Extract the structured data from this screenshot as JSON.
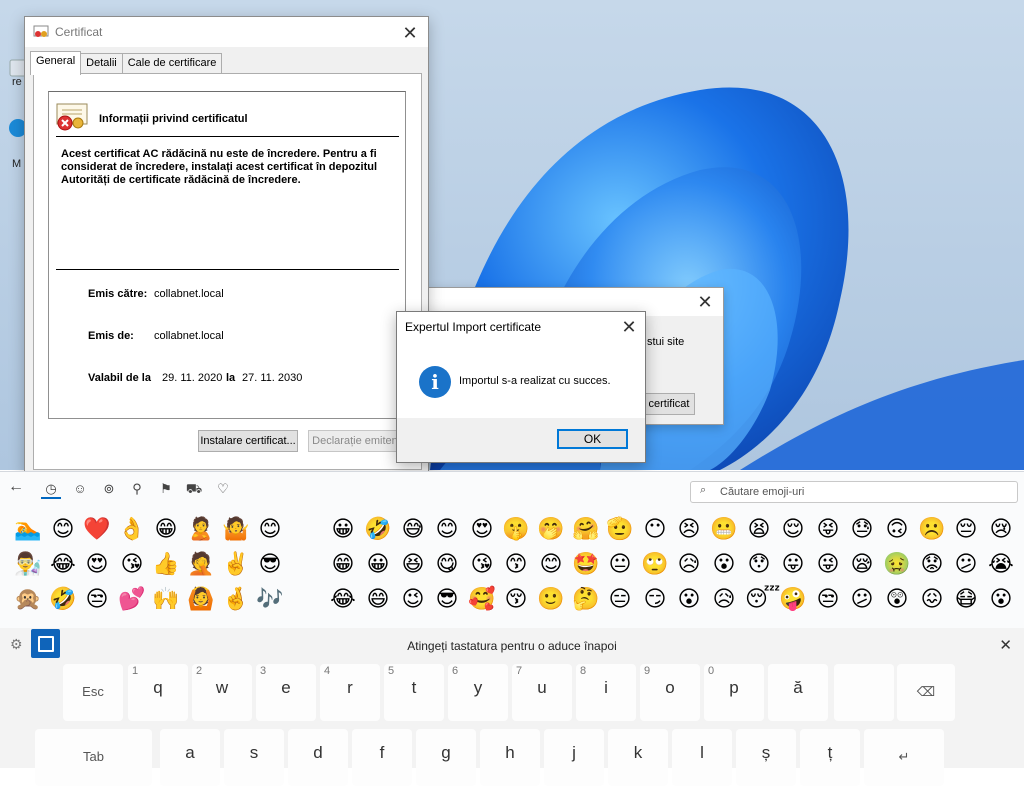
{
  "desktop": {
    "icon_labels": [
      "re",
      "M"
    ]
  },
  "certificate_window": {
    "title": "Certificat",
    "tabs": [
      "General",
      "Detalii",
      "Cale de certificare"
    ],
    "info_heading": "Informații privind certificatul",
    "warning_text": "Acest certificat AC rădăcină nu este de încredere. Pentru a fi considerat de încredere, instalați acest certificat în depozitul Autorități de certificate rădăcină de încredere.",
    "issued_to_label": "Emis către:",
    "issued_to_value": "collabnet.local",
    "issued_by_label": "Emis de:",
    "issued_by_value": "collabnet.local",
    "valid_from_label": "Valabil de la",
    "valid_from_value": "29. 11. 2020",
    "valid_to_label": "la",
    "valid_to_value": "27. 11. 2030",
    "install_button": "Instalare certificat...",
    "issuer_statement_button": "Declarație emitent"
  },
  "background_dialog": {
    "partial_text": "stui site",
    "partial_button": "certificat"
  },
  "import_dialog": {
    "title": "Expertul Import certificate",
    "message": "Importul s-a realizat cu succes.",
    "ok_button": "OK"
  },
  "emoji_panel": {
    "search_placeholder": "Căutare emoji-uri",
    "categories": [
      "back-arrow-icon",
      "recent-icon",
      "smiley-icon",
      "people-icon",
      "celebration-icon",
      "food-icon",
      "travel-icon",
      "symbols-icon",
      "heart-icon"
    ],
    "rows": [
      [
        "🏊",
        "😊",
        "❤️",
        "👌",
        "😁",
        "🙎",
        "🤷",
        "😊",
        "",
        "😀",
        "🤣",
        "😅",
        "😊",
        "😍",
        "🤫",
        "🤭",
        "🤗",
        "🫡",
        "😶",
        "😣",
        "😬",
        "😫",
        "😌",
        "😝",
        "😓",
        "🙃",
        "☹️",
        "😔",
        "😢",
        "😧"
      ],
      [
        "👨‍🔬",
        "😂",
        "😍",
        "😘",
        "👍",
        "🤦",
        "✌️",
        "😎",
        "",
        "😁",
        "😀",
        "😆",
        "😋",
        "😘",
        "😙",
        "😊",
        "🤩",
        "😐",
        "🙄",
        "😥",
        "😮",
        "😯",
        "😛",
        "😜",
        "😪",
        "🤢",
        "😟",
        "😕",
        "😭",
        "😨"
      ],
      [
        "🙊",
        "🤣",
        "😒",
        "💕",
        "🙌",
        "🙆",
        "🤞",
        "🎶",
        "",
        "😂",
        "😄",
        "😉",
        "😎",
        "🥰",
        "😚",
        "🙂",
        "🤔",
        "😑",
        "😏",
        "😮",
        "😥",
        "😴",
        "🤪",
        "😒",
        "😕",
        "😲",
        "😖",
        "😷",
        "😮",
        "😩"
      ]
    ]
  },
  "keyboard": {
    "hint": "Atingeți tastatura pentru o aduce înapoi",
    "row1": [
      {
        "label": "Esc"
      },
      {
        "num": "1",
        "ch": "q"
      },
      {
        "num": "2",
        "ch": "w"
      },
      {
        "num": "3",
        "ch": "e"
      },
      {
        "num": "4",
        "ch": "r"
      },
      {
        "num": "5",
        "ch": "t"
      },
      {
        "num": "6",
        "ch": "y"
      },
      {
        "num": "7",
        "ch": "u"
      },
      {
        "num": "8",
        "ch": "i"
      },
      {
        "num": "9",
        "ch": "o"
      },
      {
        "num": "0",
        "ch": "p"
      },
      {
        "ch": "ă"
      },
      {
        "ch": ""
      },
      {
        "label": "⌫"
      }
    ],
    "row2": [
      {
        "label": "Tab"
      },
      {
        "ch": "a"
      },
      {
        "ch": "s"
      },
      {
        "ch": "d"
      },
      {
        "ch": "f"
      },
      {
        "ch": "g"
      },
      {
        "ch": "h"
      },
      {
        "ch": "j"
      },
      {
        "ch": "k"
      },
      {
        "ch": "l"
      },
      {
        "ch": "ș"
      },
      {
        "ch": "ț"
      },
      {
        "label": "↵"
      }
    ]
  }
}
